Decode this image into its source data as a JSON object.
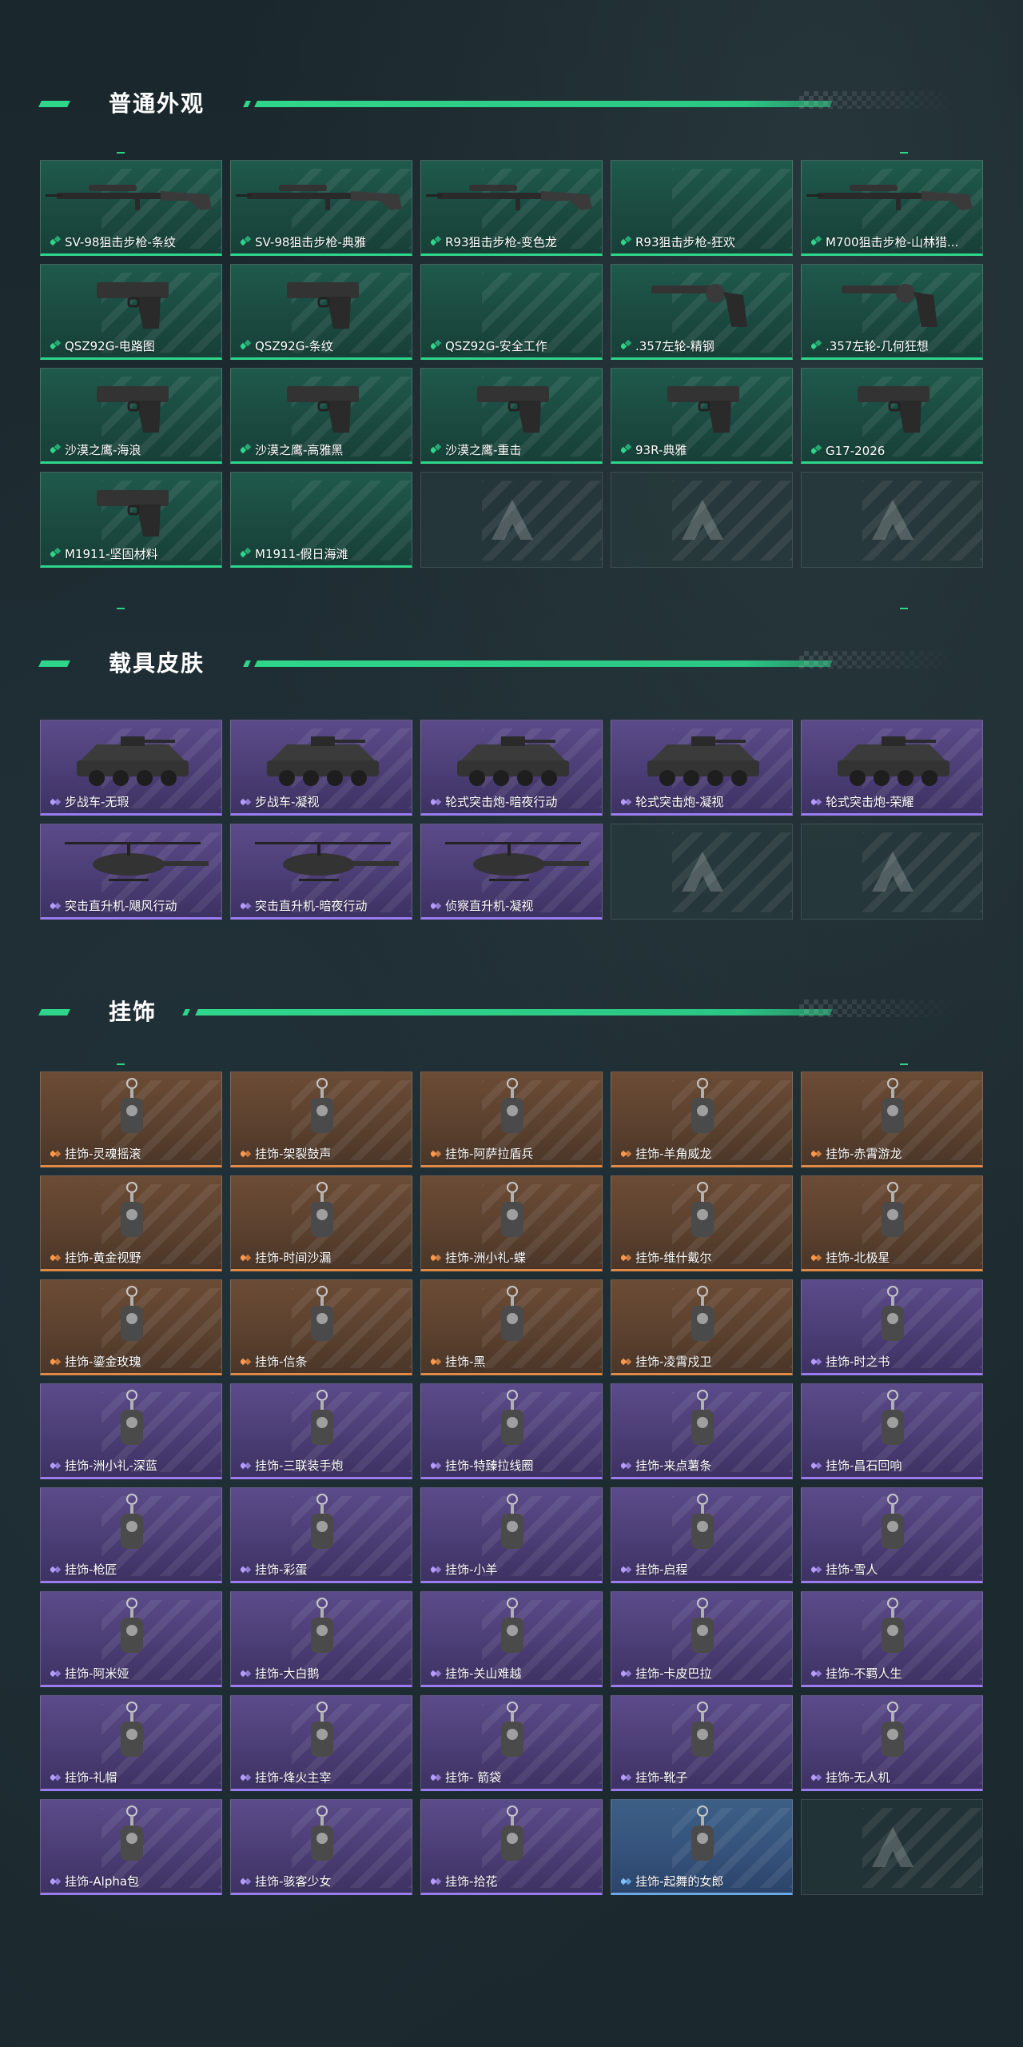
{
  "sections": [
    {
      "title": "普通外观",
      "items": [
        {
          "label": "SV-98狙击步枪-条纹",
          "rarity": "green",
          "icon": "sniper-rifle-icon"
        },
        {
          "label": "SV-98狙击步枪-典雅",
          "rarity": "green",
          "icon": "sniper-rifle-icon"
        },
        {
          "label": "R93狙击步枪-变色龙",
          "rarity": "green",
          "icon": "sniper-rifle-icon"
        },
        {
          "label": "R93狙击步枪-狂欢",
          "rarity": "green",
          "icon": ""
        },
        {
          "label": "M700狙击步枪-山林猎...",
          "rarity": "green",
          "icon": "sniper-rifle-icon"
        },
        {
          "label": "QSZ92G-电路图",
          "rarity": "green",
          "icon": "pistol-icon"
        },
        {
          "label": "QSZ92G-条纹",
          "rarity": "green",
          "icon": "pistol-icon"
        },
        {
          "label": "QSZ92G-安全工作",
          "rarity": "green",
          "icon": ""
        },
        {
          "label": ".357左轮-精钢",
          "rarity": "green",
          "icon": "revolver-icon"
        },
        {
          "label": ".357左轮-几何狂想",
          "rarity": "green",
          "icon": "revolver-icon"
        },
        {
          "label": "沙漠之鹰-海浪",
          "rarity": "green",
          "icon": "pistol-icon"
        },
        {
          "label": "沙漠之鹰-高雅黑",
          "rarity": "green",
          "icon": "pistol-icon"
        },
        {
          "label": "沙漠之鹰-重击",
          "rarity": "green",
          "icon": "pistol-icon"
        },
        {
          "label": "93R-典雅",
          "rarity": "green",
          "icon": "pistol-icon"
        },
        {
          "label": "G17-2026",
          "rarity": "green",
          "icon": "pistol-icon"
        },
        {
          "label": "M1911-坚固材料",
          "rarity": "green",
          "icon": "pistol-icon"
        },
        {
          "label": "M1911-假日海滩",
          "rarity": "green",
          "icon": ""
        },
        {
          "label": "",
          "rarity": "empty",
          "icon": "placeholder-logo-icon"
        },
        {
          "label": "",
          "rarity": "empty",
          "icon": "placeholder-logo-icon"
        },
        {
          "label": "",
          "rarity": "empty",
          "icon": "placeholder-logo-icon"
        }
      ]
    },
    {
      "title": "载具皮肤",
      "items": [
        {
          "label": "步战车-无瑕",
          "rarity": "purple",
          "icon": "ifv-vehicle-icon"
        },
        {
          "label": "步战车-凝视",
          "rarity": "purple",
          "icon": "ifv-vehicle-icon"
        },
        {
          "label": "轮式突击炮-暗夜行动",
          "rarity": "purple",
          "icon": "armored-car-icon"
        },
        {
          "label": "轮式突击炮-凝视",
          "rarity": "purple",
          "icon": "armored-car-icon"
        },
        {
          "label": "轮式突击炮-荣耀",
          "rarity": "purple",
          "icon": "armored-car-icon"
        },
        {
          "label": "突击直升机-飓风行动",
          "rarity": "purple",
          "icon": "helicopter-icon"
        },
        {
          "label": "突击直升机-暗夜行动",
          "rarity": "purple",
          "icon": "helicopter-icon"
        },
        {
          "label": "侦察直升机-凝视",
          "rarity": "purple",
          "icon": "helicopter-icon"
        },
        {
          "label": "",
          "rarity": "empty",
          "icon": "placeholder-logo-icon"
        },
        {
          "label": "",
          "rarity": "empty",
          "icon": "placeholder-logo-icon"
        }
      ]
    },
    {
      "title": "挂饰",
      "items": [
        {
          "label": "挂饰-灵魂摇滚",
          "rarity": "orange",
          "icon": "charm-icon"
        },
        {
          "label": "挂饰-架裂鼓声",
          "rarity": "orange",
          "icon": "charm-icon"
        },
        {
          "label": "挂饰-阿萨拉盾兵",
          "rarity": "orange",
          "icon": "charm-icon"
        },
        {
          "label": "挂饰-羊角威龙",
          "rarity": "orange",
          "icon": "charm-icon"
        },
        {
          "label": "挂饰-赤霄游龙",
          "rarity": "orange",
          "icon": "charm-icon"
        },
        {
          "label": "挂饰-黄金视野",
          "rarity": "orange",
          "icon": "charm-icon"
        },
        {
          "label": "挂饰-时间沙漏",
          "rarity": "orange",
          "icon": "charm-icon"
        },
        {
          "label": "挂饰-洲小礼-蝶",
          "rarity": "orange",
          "icon": "charm-icon"
        },
        {
          "label": "挂饰-维什戴尔",
          "rarity": "orange",
          "icon": "charm-icon"
        },
        {
          "label": "挂饰-北极星",
          "rarity": "orange",
          "icon": "charm-icon"
        },
        {
          "label": "挂饰-鎏金玫瑰",
          "rarity": "orange",
          "icon": "charm-icon"
        },
        {
          "label": "挂饰-信条",
          "rarity": "orange",
          "icon": "charm-icon"
        },
        {
          "label": "挂饰-黑",
          "rarity": "orange",
          "icon": "charm-icon"
        },
        {
          "label": "挂饰-凌霄戍卫",
          "rarity": "orange",
          "icon": "charm-icon"
        },
        {
          "label": "挂饰-时之书",
          "rarity": "purple",
          "icon": "charm-icon"
        },
        {
          "label": "挂饰-洲小礼-深蓝",
          "rarity": "purple",
          "icon": "charm-icon"
        },
        {
          "label": "挂饰-三联装手炮",
          "rarity": "purple",
          "icon": "charm-icon"
        },
        {
          "label": "挂饰-特臻拉线圈",
          "rarity": "purple",
          "icon": "charm-icon"
        },
        {
          "label": "挂饰-来点薯条",
          "rarity": "purple",
          "icon": "charm-icon"
        },
        {
          "label": "挂饰-昌石回响",
          "rarity": "purple",
          "icon": "charm-icon"
        },
        {
          "label": "挂饰-枪匠",
          "rarity": "purple",
          "icon": "charm-icon"
        },
        {
          "label": "挂饰-彩蛋",
          "rarity": "purple",
          "icon": "charm-icon"
        },
        {
          "label": "挂饰-小羊",
          "rarity": "purple",
          "icon": "charm-icon"
        },
        {
          "label": "挂饰-启程",
          "rarity": "purple",
          "icon": "charm-icon"
        },
        {
          "label": "挂饰-雪人",
          "rarity": "purple",
          "icon": "charm-icon"
        },
        {
          "label": "挂饰-阿米娅",
          "rarity": "purple",
          "icon": "charm-icon"
        },
        {
          "label": "挂饰-大白鹅",
          "rarity": "purple",
          "icon": "charm-icon"
        },
        {
          "label": "挂饰-关山难越",
          "rarity": "purple",
          "icon": "charm-icon"
        },
        {
          "label": "挂饰-卡皮巴拉",
          "rarity": "purple",
          "icon": "charm-icon"
        },
        {
          "label": "挂饰-不羁人生",
          "rarity": "purple",
          "icon": "charm-icon"
        },
        {
          "label": "挂饰-礼帽",
          "rarity": "purple",
          "icon": "charm-icon"
        },
        {
          "label": "挂饰-烽火主宰",
          "rarity": "purple",
          "icon": "charm-icon"
        },
        {
          "label": "挂饰- 箭袋",
          "rarity": "purple",
          "icon": "charm-icon"
        },
        {
          "label": "挂饰-靴子",
          "rarity": "purple",
          "icon": "charm-icon"
        },
        {
          "label": "挂饰-无人机",
          "rarity": "purple",
          "icon": "charm-icon"
        },
        {
          "label": "挂饰-Alpha包",
          "rarity": "purple",
          "icon": "charm-icon"
        },
        {
          "label": "挂饰-骇客少女",
          "rarity": "purple",
          "icon": "charm-icon"
        },
        {
          "label": "挂饰-拾花",
          "rarity": "purple",
          "icon": "charm-icon"
        },
        {
          "label": "挂饰-起舞的女郎",
          "rarity": "blue",
          "icon": "charm-icon"
        },
        {
          "label": "",
          "rarity": "empty",
          "icon": "placeholder-logo-icon"
        }
      ]
    }
  ],
  "colors": {
    "accent": "#2fd68a",
    "green_rarity": "#2fd68a",
    "purple_rarity": "#9a7cf0",
    "orange_rarity": "#e08a48",
    "blue_rarity": "#6aa8e8"
  }
}
